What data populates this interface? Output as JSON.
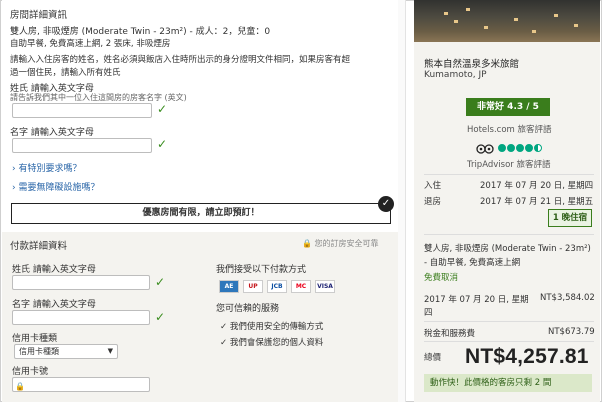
{
  "room": {
    "section_title": "房間詳細資訊",
    "room_line": "雙人房, 非吸煙房 (Moderate Twin - 23m²) - 成人：2，兒童：0",
    "amenities": "自助早餐, 免費高速上網, 2 張床, 非吸煙房",
    "instruction_1": "請輸入入住房客的姓名，姓名必須與飯店入住時所出示的身分證明文件相同，如果房客有超",
    "instruction_2": "過一個住民，請輸入所有姓氏",
    "surname_label": "姓氏 請輸入英文字母",
    "surname_hint": "請告訴我們其中一位入住這間房的房客名字 (英文)",
    "givenname_label": "名字 請輸入英文字母",
    "special_request_link": "有特別要求嗎？",
    "accessibility_link": "需要無障礙設施嗎？"
  },
  "banner": {
    "text": "優惠房間有限，請立即預訂！"
  },
  "payment": {
    "section_title": "付款詳細資料",
    "secure_note": "您的訂房安全可靠",
    "surname_label": "姓氏 請輸入英文字母",
    "givenname_label": "名字 請輸入英文字母",
    "card_type_label": "信用卡種類",
    "card_type_value": "信用卡種類",
    "card_number_label": "信用卡號",
    "accept_title": "我們接受以下付款方式",
    "card_logos": [
      "AE",
      "UP",
      "JCB",
      "MC",
      "VISA"
    ],
    "trusted_title": "您可信賴的服務",
    "trusted_1": "我們使用安全的傳輸方式",
    "trusted_2": "我們會保護您的個人資料"
  },
  "hotel": {
    "name": "熊本自然溫泉多米旅館",
    "location": "Kumamoto, JP",
    "score_badge": "非常好 4.3 / 5",
    "hotels_reviews": "Hotels.com 旅客評語",
    "ta_reviews": "TripAdvisor 旅客評語",
    "tripadvisor_rating": 4.5,
    "checkin_label": "入住",
    "checkin_date": "2017 年 07 月 20 日, 星期四",
    "checkout_label": "退房",
    "checkout_date": "2017 年 07 月 21 日, 星期五",
    "nights": "1 晚住宿",
    "room_summary_1": "雙人房, 非吸煙房 (Moderate Twin - 23m²)",
    "room_summary_2": "- 自助早餐, 免費高速上網",
    "free_cancel": "免費取消",
    "night_date_1": "2017 年 07 月 20 日, 星期",
    "night_date_2": "四",
    "night_price": "NT$3,584.02",
    "tax_label": "稅金和服務費",
    "tax_value": "NT$673.79",
    "total_label": "總價",
    "total_value": "NT$4,257.81",
    "urgent": "動作快！此價格的客房只剩 2 間"
  },
  "colors": {
    "brand_green": "#3a7d1c",
    "link_blue": "#2a66a8",
    "panel_bg": "#f4f3ef"
  }
}
